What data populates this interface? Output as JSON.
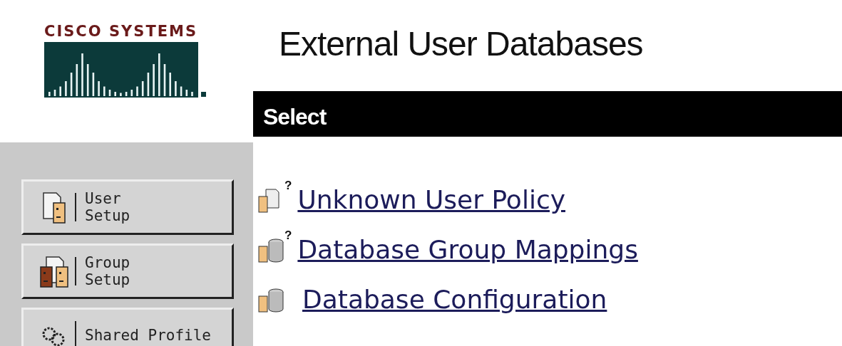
{
  "logo": {
    "text": "CISCO SYSTEMS"
  },
  "nav_buttons": [
    {
      "kind": "user",
      "lines": [
        "User",
        "Setup"
      ]
    },
    {
      "kind": "group",
      "lines": [
        "Group",
        "Setup"
      ]
    },
    {
      "kind": "profile",
      "lines": [
        "Shared Profile"
      ]
    }
  ],
  "title": "External User Databases",
  "section_bar": "Select",
  "links": [
    {
      "kind": "unknown",
      "icon_mark": "?",
      "label": "Unknown User Policy"
    },
    {
      "kind": "mapping",
      "icon_mark": "?",
      "label": "Database Group Mappings"
    },
    {
      "kind": "database",
      "label": "Database Configuration"
    }
  ]
}
